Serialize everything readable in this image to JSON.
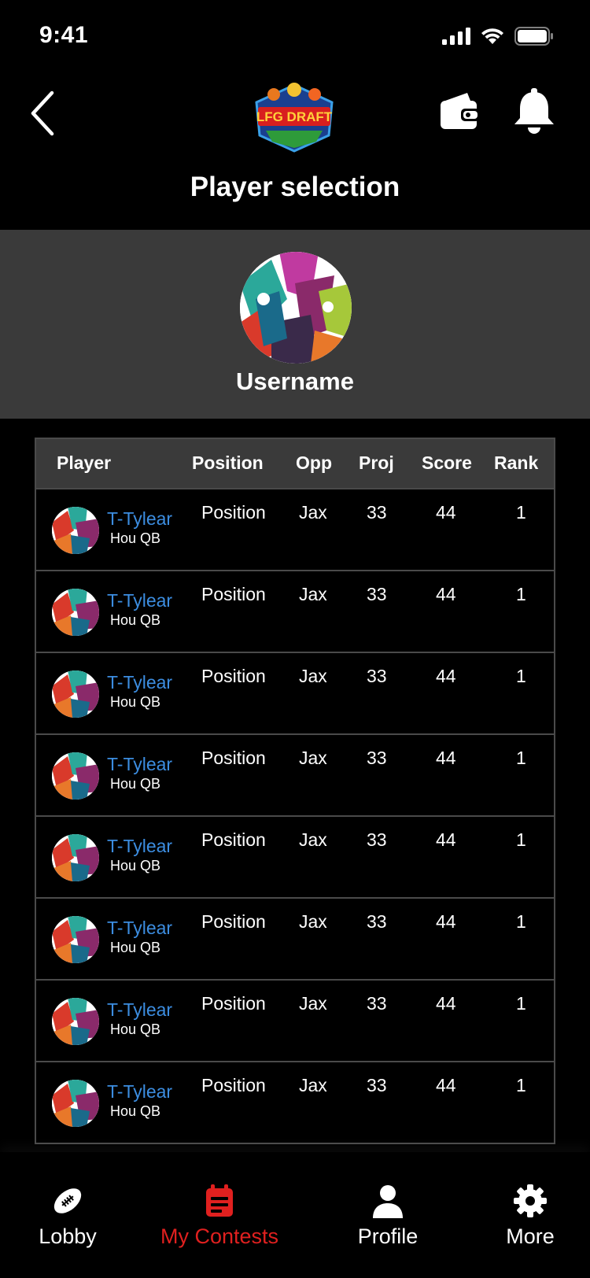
{
  "status": {
    "time": "9:41"
  },
  "header": {
    "title": "Player selection"
  },
  "profile": {
    "username": "Username"
  },
  "table": {
    "headers": [
      "Player",
      "Position",
      "Opp",
      "Proj",
      "Score",
      "Rank"
    ],
    "rows": [
      {
        "name": "T-Tylear",
        "team": "Hou QB",
        "position": "Position",
        "opp": "Jax",
        "proj": "33",
        "score": "44",
        "rank": "1"
      },
      {
        "name": "T-Tylear",
        "team": "Hou QB",
        "position": "Position",
        "opp": "Jax",
        "proj": "33",
        "score": "44",
        "rank": "1"
      },
      {
        "name": "T-Tylear",
        "team": "Hou QB",
        "position": "Position",
        "opp": "Jax",
        "proj": "33",
        "score": "44",
        "rank": "1"
      },
      {
        "name": "T-Tylear",
        "team": "Hou QB",
        "position": "Position",
        "opp": "Jax",
        "proj": "33",
        "score": "44",
        "rank": "1"
      },
      {
        "name": "T-Tylear",
        "team": "Hou QB",
        "position": "Position",
        "opp": "Jax",
        "proj": "33",
        "score": "44",
        "rank": "1"
      },
      {
        "name": "T-Tylear",
        "team": "Hou QB",
        "position": "Position",
        "opp": "Jax",
        "proj": "33",
        "score": "44",
        "rank": "1"
      },
      {
        "name": "T-Tylear",
        "team": "Hou QB",
        "position": "Position",
        "opp": "Jax",
        "proj": "33",
        "score": "44",
        "rank": "1"
      },
      {
        "name": "T-Tylear",
        "team": "Hou QB",
        "position": "Position",
        "opp": "Jax",
        "proj": "33",
        "score": "44",
        "rank": "1"
      }
    ]
  },
  "tabs": [
    {
      "label": "Lobby",
      "icon": "football-icon",
      "active": false
    },
    {
      "label": "My Contests",
      "icon": "calendar-icon",
      "active": true
    },
    {
      "label": "Profile",
      "icon": "person-icon",
      "active": false
    },
    {
      "label": "More",
      "icon": "gear-icon",
      "active": false
    }
  ],
  "colors": {
    "accent": "#e0201f",
    "link": "#3c8de0",
    "band": "#3a3a3a"
  },
  "logo_text": "LFG DRAFT"
}
